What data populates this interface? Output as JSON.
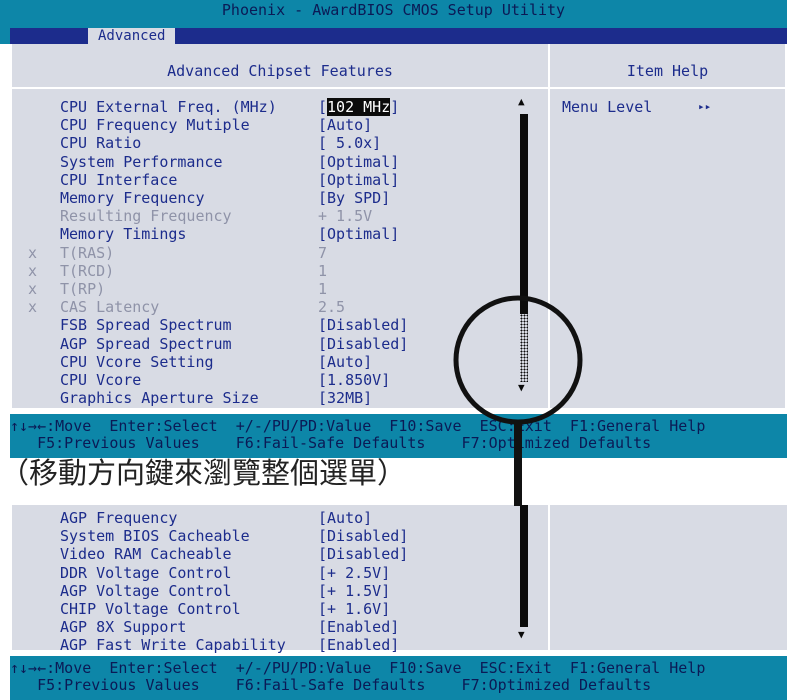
{
  "header": {
    "title": "Phoenix - AwardBIOS CMOS Setup Utility",
    "active_tab": "Advanced"
  },
  "panel": {
    "left_title": "Advanced Chipset Features",
    "right_title": "Item Help",
    "menu_level_label": "Menu Level",
    "menu_level_arrows": "▸▸"
  },
  "rows1": [
    {
      "mark": "",
      "label": "CPU External Freq. (MHz)",
      "value_pre": "[",
      "value_hl": "102 MHz",
      "value_post": "]",
      "grey": false
    },
    {
      "mark": "",
      "label": "CPU Frequency Mutiple",
      "value": "[Auto]",
      "grey": false
    },
    {
      "mark": "",
      "label": "CPU Ratio",
      "value": "[ 5.0x]",
      "grey": false
    },
    {
      "mark": "",
      "label": "System Performance",
      "value": "[Optimal]",
      "grey": false
    },
    {
      "mark": "",
      "label": "CPU Interface",
      "value": "[Optimal]",
      "grey": false
    },
    {
      "mark": "",
      "label": "Memory Frequency",
      "value": "[By SPD]",
      "grey": false
    },
    {
      "mark": "",
      "label": "Resulting Frequency",
      "value": "+ 1.5V",
      "grey": true
    },
    {
      "mark": "",
      "label": "Memory Timings",
      "value": "[Optimal]",
      "grey": false
    },
    {
      "mark": "x",
      "label": "T(RAS)",
      "value": "7",
      "grey": true
    },
    {
      "mark": "x",
      "label": "T(RCD)",
      "value": "1",
      "grey": true
    },
    {
      "mark": "x",
      "label": "T(RP)",
      "value": "1",
      "grey": true
    },
    {
      "mark": "x",
      "label": "CAS Latency",
      "value": "2.5",
      "grey": true
    },
    {
      "mark": "",
      "label": "FSB Spread Spectrum",
      "value": "[Disabled]",
      "grey": false
    },
    {
      "mark": "",
      "label": "AGP Spread Spectrum",
      "value": "[Disabled]",
      "grey": false
    },
    {
      "mark": "",
      "label": "CPU Vcore Setting",
      "value": "[Auto]",
      "grey": false
    },
    {
      "mark": "",
      "label": "CPU Vcore",
      "value": "[1.850V]",
      "grey": false
    },
    {
      "mark": "",
      "label": "Graphics Aperture Size",
      "value": "[32MB]",
      "grey": false
    }
  ],
  "rows2": [
    {
      "label": "AGP Frequency",
      "value": "[Auto]"
    },
    {
      "label": "System BIOS Cacheable",
      "value": "[Disabled]"
    },
    {
      "label": "Video RAM Cacheable",
      "value": "[Disabled]"
    },
    {
      "label": "DDR Voltage Control",
      "value": "[+ 2.5V]"
    },
    {
      "label": "AGP Voltage Control",
      "value": "[+ 1.5V]"
    },
    {
      "label": "CHIP Voltage Control",
      "value": "[+ 1.6V]"
    },
    {
      "label": "AGP 8X Support",
      "value": "[Enabled]"
    },
    {
      "label": "AGP Fast Write Capability",
      "value": "[Enabled]"
    }
  ],
  "help": {
    "line1": "↑↓→←:Move  Enter:Select  +/-/PU/PD:Value  F10:Save  ESC:Exit  F1:General Help",
    "line2": "   F5:Previous Values    F6:Fail-Safe Defaults    F7:Optimized Defaults"
  },
  "caption": "（移動方向鍵來瀏覽整個選單）",
  "scroll": {
    "up": "▲",
    "down": "▼"
  }
}
